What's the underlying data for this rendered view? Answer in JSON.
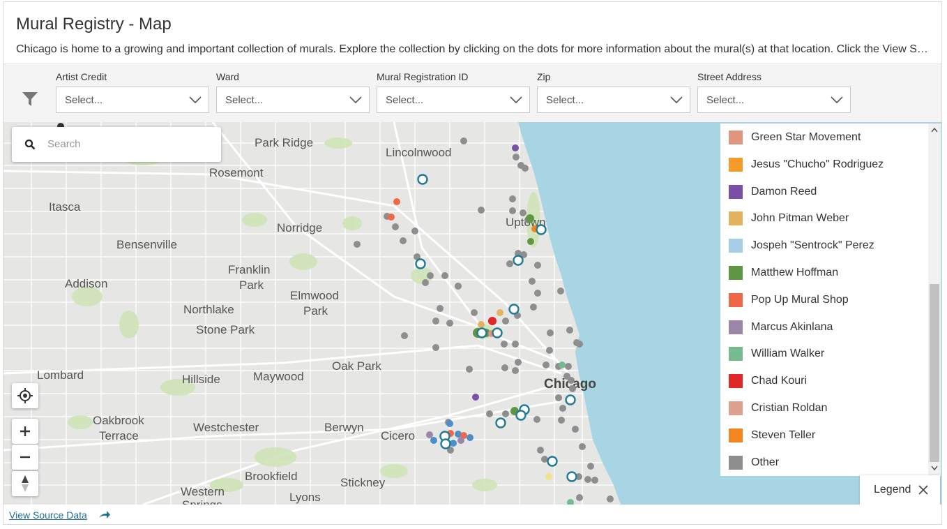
{
  "header": {
    "title": "Mural Registry - Map",
    "description": "Chicago is home to a growing and important collection of murals. Explore the collection by clicking on the dots for more information about the mural(s) at that location. Click the View Source …"
  },
  "filters": [
    {
      "label": "Artist Credit",
      "value": "Select..."
    },
    {
      "label": "Ward",
      "value": "Select..."
    },
    {
      "label": "Mural Registration ID",
      "value": "Select..."
    },
    {
      "label": "Zip",
      "value": "Select..."
    },
    {
      "label": "Street Address",
      "value": "Select..."
    }
  ],
  "map": {
    "search_placeholder": "Search",
    "place_labels": [
      "Park Ridge",
      "Lincolnwood",
      "Rosemont",
      "Itasca",
      "Norridge",
      "Uptown",
      "Bensenville",
      "Franklin",
      "Park",
      "Addison",
      "Elmwood",
      "Park",
      "Northlake",
      "Stone Park",
      "Oak Park",
      "Lombard",
      "Hillside",
      "Maywood",
      "Chicago",
      "Oakbrook",
      "Terrace",
      "Westchester",
      "Berwyn",
      "Cicero",
      "Brookfield",
      "Stickney",
      "Western",
      "Springs",
      "Lyons"
    ]
  },
  "legend": {
    "items": [
      {
        "name": "Green Star Movement",
        "color": "#e0957f"
      },
      {
        "name": "Jesus \"Chucho\" Rodriguez",
        "color": "#f49b2a"
      },
      {
        "name": "Damon Reed",
        "color": "#7a4fa8"
      },
      {
        "name": "John Pitman Weber",
        "color": "#e3b25e"
      },
      {
        "name": "Jospeh \"Sentrock\" Perez",
        "color": "#a6cfe6"
      },
      {
        "name": "Matthew Hoffman",
        "color": "#5f9644"
      },
      {
        "name": "Pop Up Mural Shop",
        "color": "#f0684a"
      },
      {
        "name": "Marcus Akinlana",
        "color": "#9c85a8"
      },
      {
        "name": "William Walker",
        "color": "#74bb90"
      },
      {
        "name": "Chad Kouri",
        "color": "#e02828"
      },
      {
        "name": "Cristian Roldan",
        "color": "#dea08e"
      },
      {
        "name": "Steven Teller",
        "color": "#f5861f"
      },
      {
        "name": "Other",
        "color": "#8e8e8e"
      }
    ],
    "toggle_label": "Legend"
  },
  "footer": {
    "view_source": "View Source Data"
  },
  "colors": {
    "water": "#a8d5e4",
    "accent": "#1f6f9c",
    "marker_ring": "#1f7a96"
  }
}
